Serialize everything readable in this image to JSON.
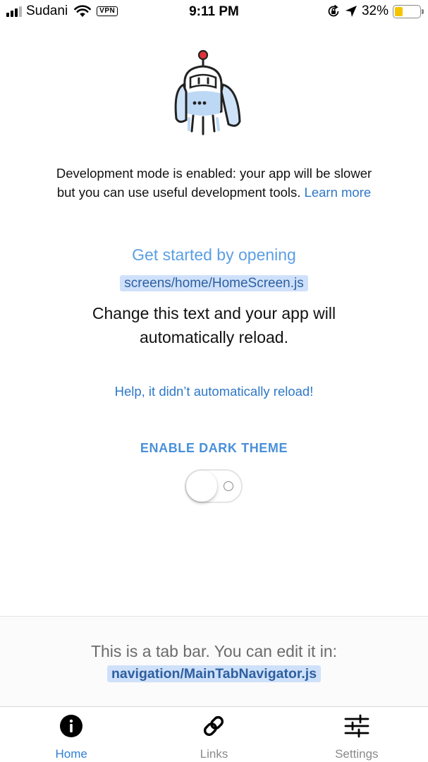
{
  "status_bar": {
    "carrier": "Sudani",
    "vpn": "VPN",
    "time": "9:11 PM",
    "battery": "32%",
    "battery_level": 0.32,
    "battery_color": "#f5c400"
  },
  "main": {
    "dev_text": "Development mode is enabled: your app will be slower but you can use useful development tools.",
    "learn_more": "Learn more",
    "get_started": "Get started by opening",
    "screen_path": "screens/home/HomeScreen.js",
    "change_text": "Change this text and your app will automatically reload.",
    "help_link": "Help, it didn’t automatically reload!",
    "dark_theme_label": "ENABLE DARK THEME",
    "dark_theme_enabled": false
  },
  "tab_info": {
    "text": "This is a tab bar. You can edit it in:",
    "path": "navigation/MainTabNavigator.js"
  },
  "tab_bar": {
    "active_color": "#2f7fd3",
    "inactive_color": "#8a8a8a",
    "tabs": [
      {
        "label": "Home",
        "icon": "info-icon",
        "active": true
      },
      {
        "label": "Links",
        "icon": "link-icon",
        "active": false
      },
      {
        "label": "Settings",
        "icon": "sliders-icon",
        "active": false
      }
    ]
  }
}
